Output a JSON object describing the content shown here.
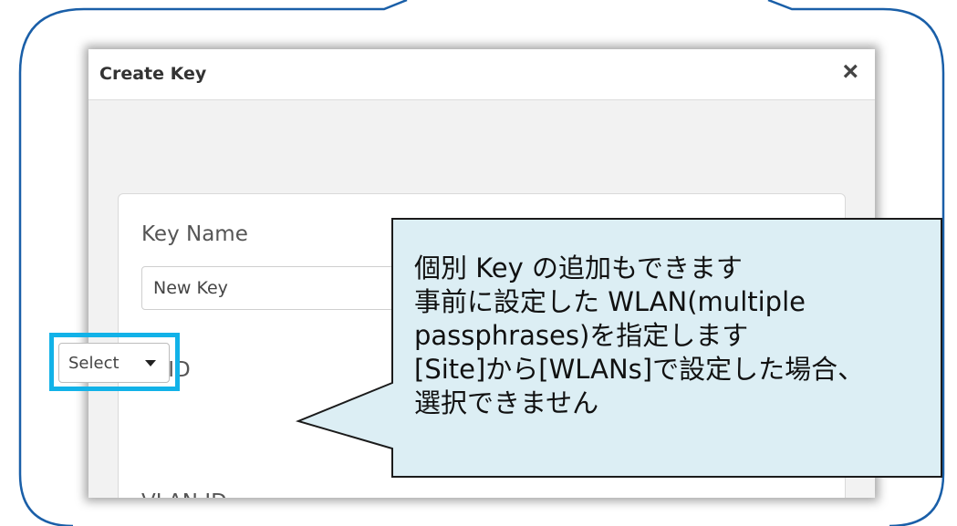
{
  "dialog": {
    "title": "Create Key",
    "close_icon": "×"
  },
  "form": {
    "key_name_label": "Key Name",
    "key_name_value": "New Key",
    "ssid_label": "SSID",
    "ssid_select_value": "Select",
    "vlan_label": "VLAN ID"
  },
  "callout": {
    "lines": [
      "個別 Key の追加もできます",
      "事前に設定した WLAN(multiple",
      "passphrases)を指定します",
      "[Site]から[WLANs]で設定した場合、",
      "選択できません"
    ]
  },
  "colors": {
    "frame_blue": "#1a5fa8",
    "highlight_blue": "#12b2e8",
    "balloon_fill": "#dceef4"
  }
}
